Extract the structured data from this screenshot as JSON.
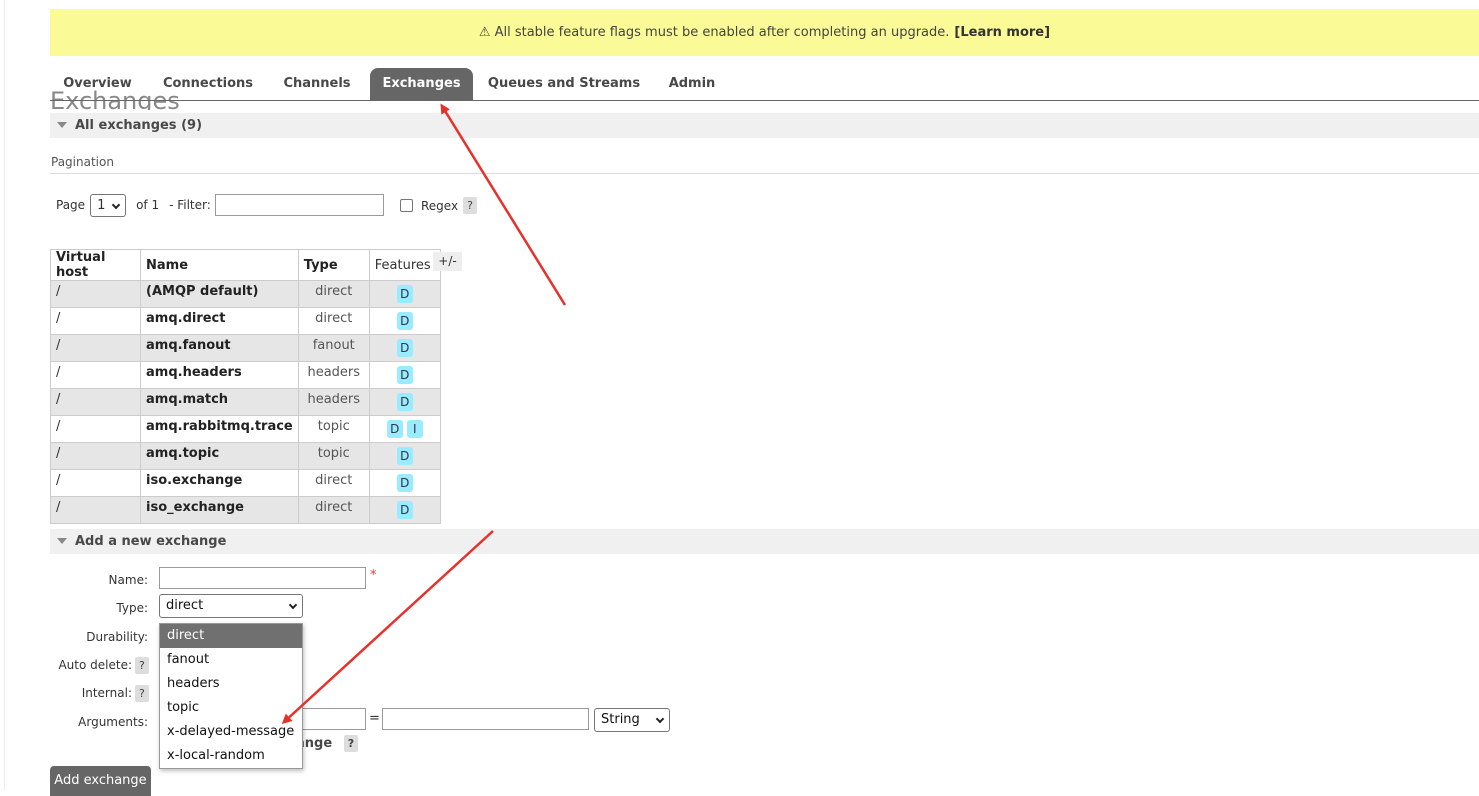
{
  "banner": {
    "icon": "warning-icon",
    "message": "All stable feature flags must be enabled after completing an upgrade.",
    "link": "[Learn more]"
  },
  "tabs": [
    {
      "label": "Overview"
    },
    {
      "label": "Connections"
    },
    {
      "label": "Channels"
    },
    {
      "label": "Exchanges",
      "active": true
    },
    {
      "label": "Queues and Streams"
    },
    {
      "label": "Admin"
    }
  ],
  "page_heading": "Exchanges",
  "all_exchanges": {
    "title": "All exchanges (9)"
  },
  "pagination": {
    "label": "Pagination",
    "page_label": "Page",
    "page_value": "1",
    "of_label": "of 1",
    "filter_label": "- Filter:",
    "filter_value": "",
    "regex_label": "Regex",
    "regex_help": "?"
  },
  "table": {
    "headers": [
      "Virtual host",
      "Name",
      "Type",
      "Features"
    ],
    "toggle_label": "+/-",
    "rows": [
      {
        "vhost": "/",
        "name": "(AMQP default)",
        "type": "direct",
        "features": [
          "D"
        ]
      },
      {
        "vhost": "/",
        "name": "amq.direct",
        "type": "direct",
        "features": [
          "D"
        ]
      },
      {
        "vhost": "/",
        "name": "amq.fanout",
        "type": "fanout",
        "features": [
          "D"
        ]
      },
      {
        "vhost": "/",
        "name": "amq.headers",
        "type": "headers",
        "features": [
          "D"
        ]
      },
      {
        "vhost": "/",
        "name": "amq.match",
        "type": "headers",
        "features": [
          "D"
        ]
      },
      {
        "vhost": "/",
        "name": "amq.rabbitmq.trace",
        "type": "topic",
        "features": [
          "D",
          "I"
        ]
      },
      {
        "vhost": "/",
        "name": "amq.topic",
        "type": "topic",
        "features": [
          "D"
        ]
      },
      {
        "vhost": "/",
        "name": "iso.exchange",
        "type": "direct",
        "features": [
          "D"
        ]
      },
      {
        "vhost": "/",
        "name": "iso_exchange",
        "type": "direct",
        "features": [
          "D"
        ]
      }
    ]
  },
  "add_exchange": {
    "title": "Add a new exchange",
    "name_label": "Name:",
    "name_value": "",
    "required_mark": "*",
    "type_label": "Type:",
    "type_value": "direct",
    "type_options": [
      "direct",
      "fanout",
      "headers",
      "topic",
      "x-delayed-message",
      "x-local-random"
    ],
    "durability_label": "Durability:",
    "auto_delete_label": "Auto delete:",
    "internal_label": "Internal:",
    "help": "?",
    "arguments_label": "Arguments:",
    "equals": "=",
    "arg_type_value": "String",
    "add_link_partial": "ange",
    "submit_label": "Add exchange"
  },
  "colors": {
    "banner_bg": "#fafa96",
    "tab_active_bg": "#666666",
    "badge_bg": "#99ebff",
    "annotation_arrow": "#e8302a"
  }
}
